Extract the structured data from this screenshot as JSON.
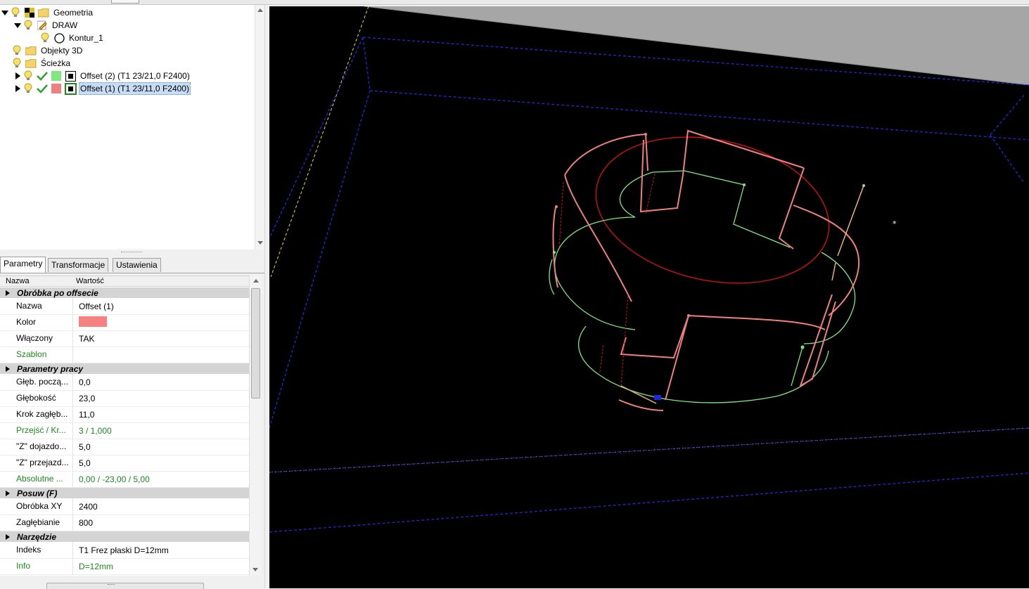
{
  "tree": {
    "items": [
      {
        "label": "Geometria",
        "icon": "folder-icon"
      },
      {
        "label": "DRAW",
        "icon": "pencil-icon"
      },
      {
        "label": "Kontur_1",
        "icon": "circle-icon"
      },
      {
        "label": "Objekty 3D",
        "icon": "folder-icon"
      },
      {
        "label": "Ścieżka",
        "icon": "folder-icon"
      },
      {
        "label": "Offset (2) (T1 23/21,0 F2400)",
        "color": "#7ee87e"
      },
      {
        "label": "Offset (1) (T1 23/11,0 F2400)",
        "color": "#f08080",
        "selected": true
      }
    ]
  },
  "tabs": [
    "Parametry",
    "Transformacje",
    "Ustawienia"
  ],
  "grid": {
    "header": {
      "name": "Nazwa",
      "value": "Wartość"
    },
    "cat_offset": "Obróbka po offsecie",
    "nazwa": {
      "name": "Nazwa",
      "value": "Offset (1)"
    },
    "kolor": {
      "name": "Kolor",
      "color": "#f78080"
    },
    "wlaczony": {
      "name": "Włączony",
      "value": "TAK"
    },
    "szablon": {
      "name": "Szablon",
      "value": ""
    },
    "cat_praca": "Parametry pracy",
    "glebpocz": {
      "name": "Głęb. począ...",
      "value": "0,0"
    },
    "glebokosc": {
      "name": "Głębokość",
      "value": "23,0"
    },
    "krok": {
      "name": "Krok zagłęb...",
      "value": "11,0"
    },
    "przejsc": {
      "name": "Przejść / Kr...",
      "value": "3 / 1,000"
    },
    "zdojazd": {
      "name": "\"Z\" dojazdo...",
      "value": "5,0"
    },
    "zprzejazd": {
      "name": "\"Z\" przejazd...",
      "value": "5,0"
    },
    "absolutne": {
      "name": "Absolutne ...",
      "value": "0,00 / -23,00 / 5,00"
    },
    "cat_posuw": "Posuw (F)",
    "obrobkaxy": {
      "name": "Obróbka XY",
      "value": "2400"
    },
    "zaglebianie": {
      "name": "Zagłębianie",
      "value": "800"
    },
    "cat_narzedzie": "Narzędzie",
    "indeks": {
      "name": "Indeks",
      "value": "T1 Frez płaski D=12mm"
    },
    "info": {
      "name": "Info",
      "value": "D=12mm"
    }
  },
  "viewport": {
    "background": "#000000",
    "toolpath_red": "#f08080",
    "toolpath_green": "#7ee87e",
    "contour_red": "#d01010",
    "stock_outline": "#2222cc"
  }
}
